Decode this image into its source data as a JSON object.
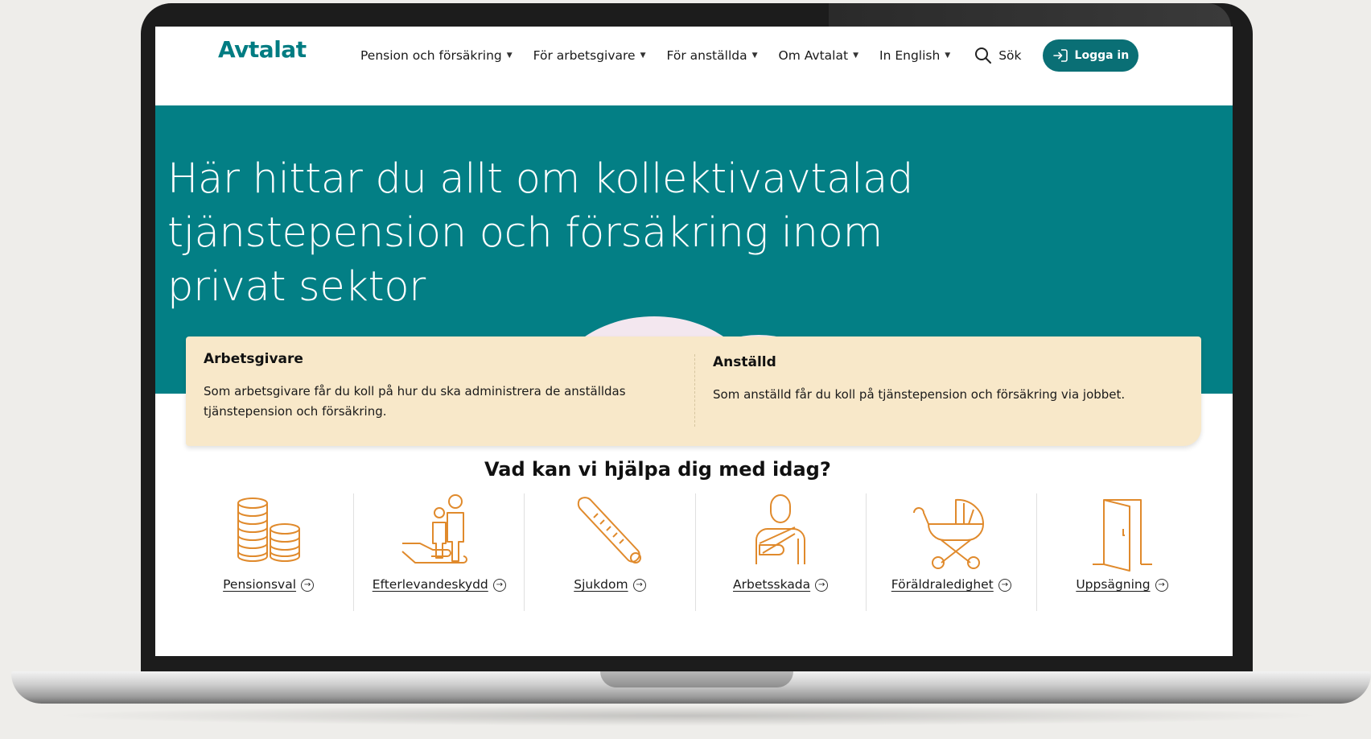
{
  "header": {
    "logo": "Avtalat",
    "nav": [
      {
        "label": "Pension och försäkring"
      },
      {
        "label": "För arbetsgivare"
      },
      {
        "label": "För anställda"
      },
      {
        "label": "Om Avtalat"
      },
      {
        "label": "In English"
      }
    ],
    "search_label": "Sök",
    "login_label": "Logga in"
  },
  "hero": {
    "title": "Här hittar du allt om kollektivavtalad tjänstepension och försäkring inom privat sektor"
  },
  "cards": [
    {
      "title": "Arbetsgivare",
      "text": "Som arbetsgivare får du koll på hur du ska administrera de anställdas tjänstepension och försäkring."
    },
    {
      "title": "Anställd",
      "text": "Som anställd får du koll på tjänstepension och försäkring via jobbet."
    }
  ],
  "help": {
    "title": "Vad kan vi hjälpa dig med idag?",
    "items": [
      {
        "label": "Pensionsval",
        "icon": "coins-icon"
      },
      {
        "label": "Efterlevandeskydd",
        "icon": "family-hand-icon"
      },
      {
        "label": "Sjukdom",
        "icon": "thermometer-icon"
      },
      {
        "label": "Arbetsskada",
        "icon": "injured-person-icon"
      },
      {
        "label": "Föräldraledighet",
        "icon": "stroller-icon"
      },
      {
        "label": "Uppsägning",
        "icon": "door-icon"
      }
    ]
  },
  "colors": {
    "brand": "#007c82",
    "hero_bg": "#037f85",
    "card_bg": "#f8e8c9",
    "icon_orange": "#e08a2c",
    "cloud": "#f3e7ef"
  }
}
